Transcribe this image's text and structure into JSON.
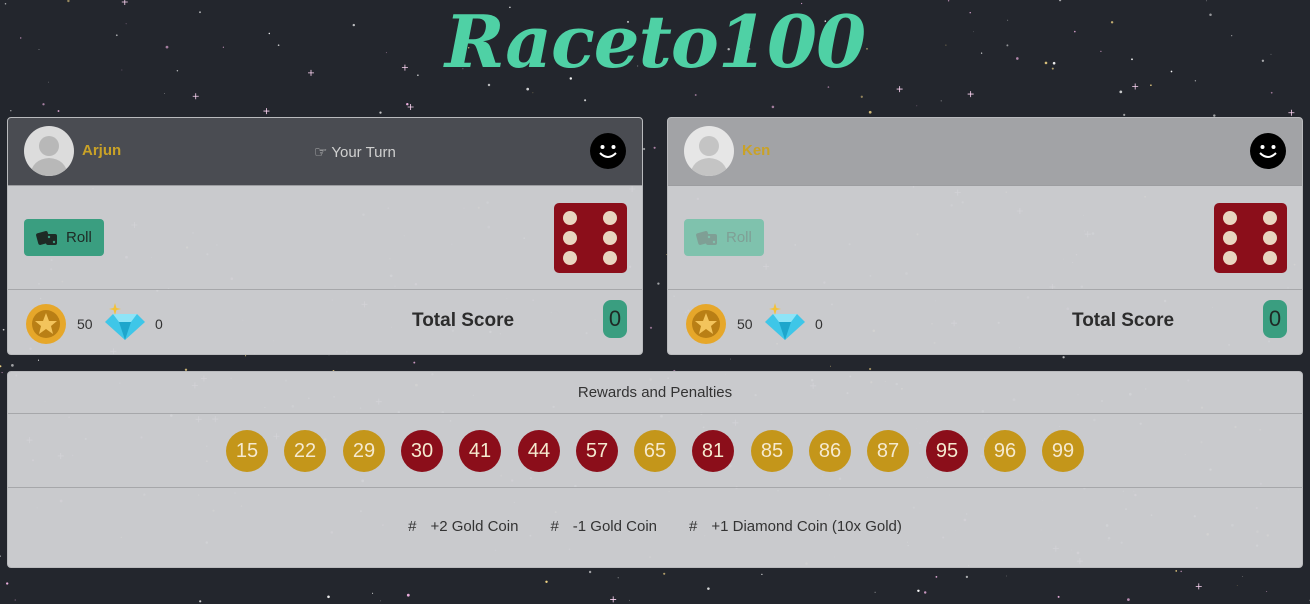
{
  "app": {
    "title": "Raceto100"
  },
  "players": [
    {
      "name": "Arjun",
      "turn_text": "Your Turn",
      "roll_label": "Roll",
      "roll_enabled": true,
      "die_value": 6,
      "gold_coins": "50",
      "diamonds": "0",
      "total_label": "Total Score",
      "total_score": "0",
      "active": true
    },
    {
      "name": "Ken",
      "turn_text": "",
      "roll_label": "Roll",
      "roll_enabled": false,
      "die_value": 6,
      "gold_coins": "50",
      "diamonds": "0",
      "total_label": "Total Score",
      "total_score": "0",
      "active": false
    }
  ],
  "rewards": {
    "title": "Rewards and Penalties",
    "cells": [
      {
        "value": "15",
        "type": "gold"
      },
      {
        "value": "22",
        "type": "gold"
      },
      {
        "value": "29",
        "type": "gold"
      },
      {
        "value": "30",
        "type": "penalty"
      },
      {
        "value": "41",
        "type": "penalty"
      },
      {
        "value": "44",
        "type": "penalty"
      },
      {
        "value": "57",
        "type": "penalty"
      },
      {
        "value": "65",
        "type": "gold"
      },
      {
        "value": "81",
        "type": "penalty"
      },
      {
        "value": "85",
        "type": "gold"
      },
      {
        "value": "86",
        "type": "gold"
      },
      {
        "value": "87",
        "type": "gold"
      },
      {
        "value": "95",
        "type": "penalty"
      },
      {
        "value": "96",
        "type": "gold"
      },
      {
        "value": "99",
        "type": "gold"
      }
    ],
    "legend": [
      {
        "symbol": "#",
        "text": "+2 Gold Coin"
      },
      {
        "symbol": "#",
        "text": "-1 Gold Coin"
      },
      {
        "symbol": "#",
        "text": "+1 Diamond Coin (10x Gold)"
      }
    ]
  },
  "colors": {
    "accent": "#4fd1a5",
    "gold": "#c4961a",
    "penalty": "#8b0e1a",
    "button": "#3a9e80"
  }
}
